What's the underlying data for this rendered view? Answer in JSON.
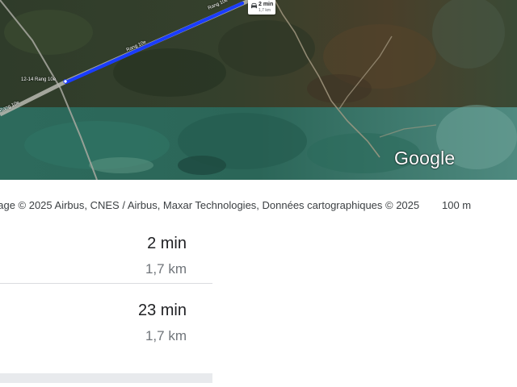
{
  "map": {
    "road_name": "Rang 10e",
    "address_pin": "12-14 Rang 10e",
    "route_callout": {
      "icon": "car-icon",
      "time": "2 min",
      "distance": "1,7 km"
    },
    "route_color": "#1a3cff",
    "logo": "Google"
  },
  "footer": {
    "attribution": "nage © 2025 Airbus, CNES / Airbus, Maxar Technologies, Données cartographiques © 2025",
    "scale": "100 m"
  },
  "options": [
    {
      "time": "2 min",
      "distance": "1,7 km"
    },
    {
      "time": "23 min",
      "distance": "1,7 km"
    }
  ]
}
